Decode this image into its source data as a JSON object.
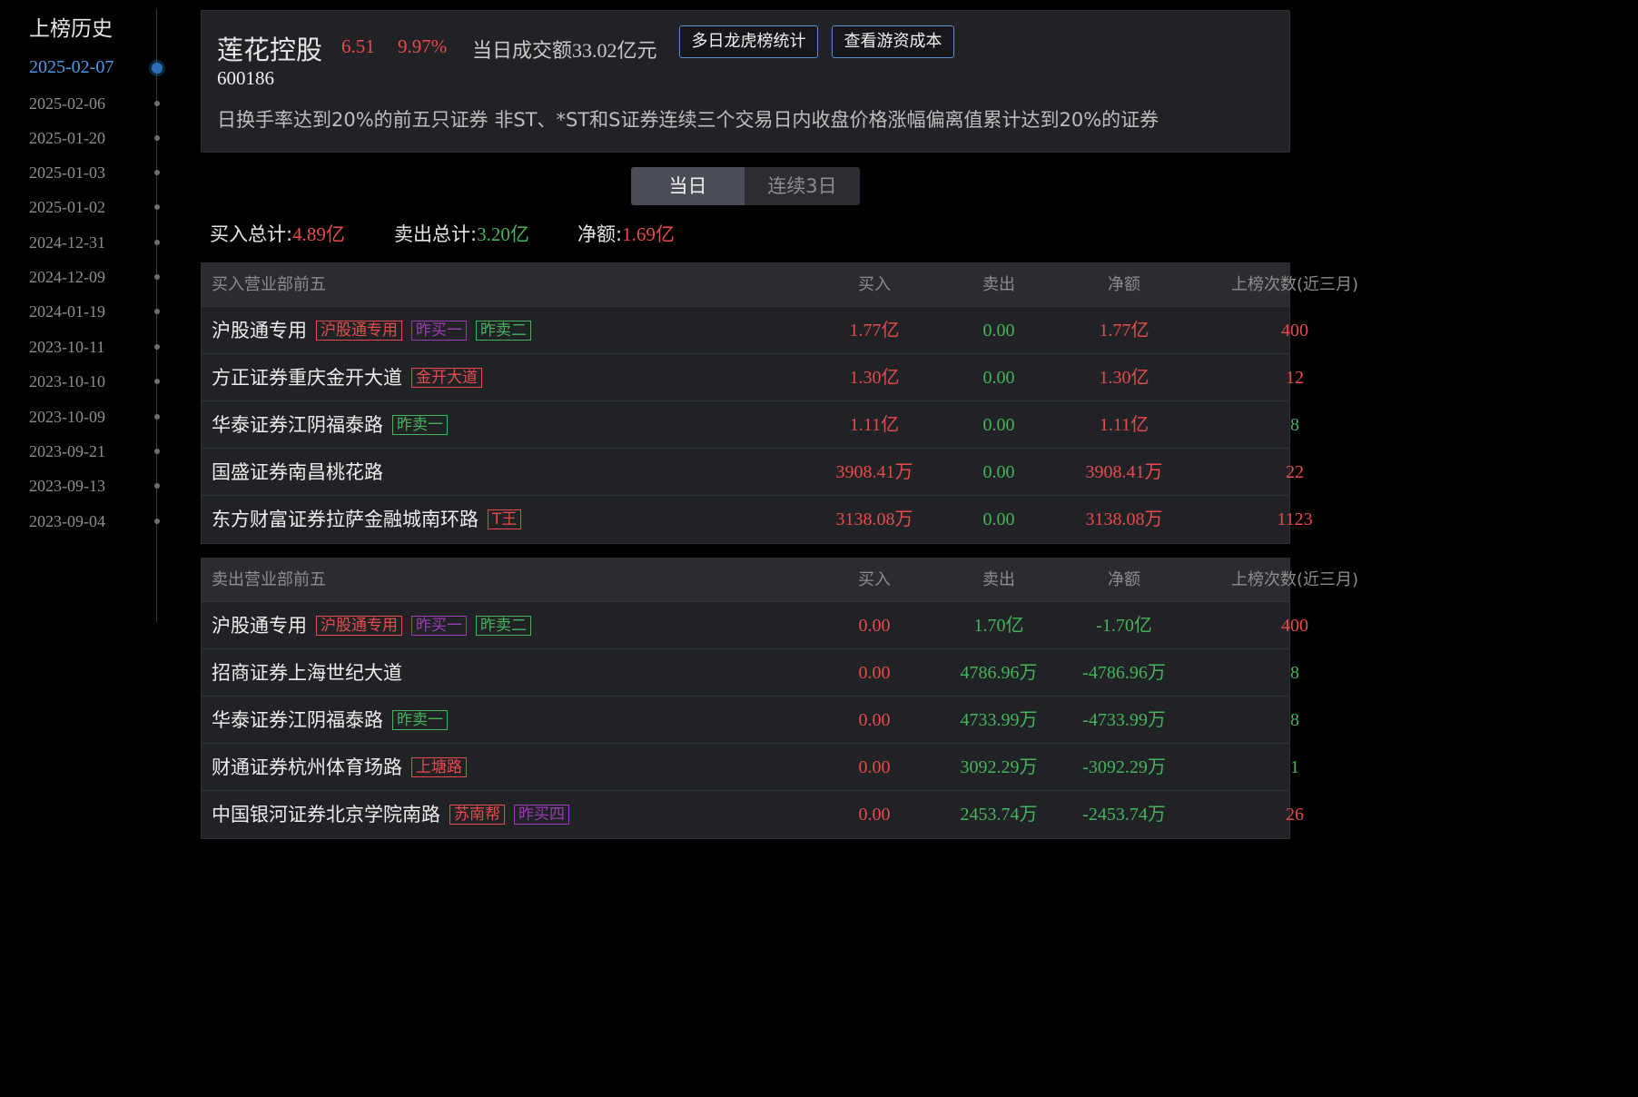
{
  "sidebar": {
    "title": "上榜历史",
    "dates": [
      "2025-02-07",
      "2025-02-06",
      "2025-01-20",
      "2025-01-03",
      "2025-01-02",
      "2024-12-31",
      "2024-12-09",
      "2024-01-19",
      "2023-10-11",
      "2023-10-10",
      "2023-10-09",
      "2023-09-21",
      "2023-09-13",
      "2023-09-04"
    ],
    "active_index": 0
  },
  "header": {
    "stock_name": "莲花控股",
    "price": "6.51",
    "change": "9.97%",
    "turnover": "当日成交额33.02亿元",
    "btn_multi_day": "多日龙虎榜统计",
    "btn_cost": "查看游资成本",
    "stock_code": "600186",
    "reason": "日换手率达到20%的前五只证券 非ST、*ST和S证券连续三个交易日内收盘价格涨幅偏离值累计达到20%的证券"
  },
  "tabs": [
    "当日",
    "连续3日"
  ],
  "summary": {
    "buy_label": "买入总计:",
    "buy_value": "4.89亿",
    "sell_label": "卖出总计:",
    "sell_value": "3.20亿",
    "net_label": "净额:",
    "net_value": "1.69亿"
  },
  "buy_table": {
    "headers": [
      "买入营业部前五",
      "买入",
      "卖出",
      "净额",
      "上榜次数(近三月)"
    ],
    "rows": [
      {
        "name": "沪股通专用",
        "tags": [
          {
            "text": "沪股通专用",
            "color": "red"
          },
          {
            "text": "昨买一",
            "color": "purple"
          },
          {
            "text": "昨卖二",
            "color": "green"
          }
        ],
        "buy": "1.77亿",
        "sell": "0.00",
        "net": "1.77亿",
        "count": "400",
        "net_color": "red",
        "count_color": "red"
      },
      {
        "name": "方正证券重庆金开大道",
        "tags": [
          {
            "text": "金开大道",
            "color": "red"
          }
        ],
        "buy": "1.30亿",
        "sell": "0.00",
        "net": "1.30亿",
        "count": "12",
        "net_color": "red",
        "count_color": "red"
      },
      {
        "name": "华泰证券江阴福泰路",
        "tags": [
          {
            "text": "昨卖一",
            "color": "green"
          }
        ],
        "buy": "1.11亿",
        "sell": "0.00",
        "net": "1.11亿",
        "count": "8",
        "net_color": "red",
        "count_color": "green"
      },
      {
        "name": "国盛证券南昌桃花路",
        "tags": [],
        "buy": "3908.41万",
        "sell": "0.00",
        "net": "3908.41万",
        "count": "22",
        "net_color": "red",
        "count_color": "red"
      },
      {
        "name": "东方财富证券拉萨金融城南环路",
        "tags": [
          {
            "text": "T王",
            "color": "red"
          }
        ],
        "buy": "3138.08万",
        "sell": "0.00",
        "net": "3138.08万",
        "count": "1123",
        "net_color": "red",
        "count_color": "red"
      }
    ]
  },
  "sell_table": {
    "headers": [
      "卖出营业部前五",
      "买入",
      "卖出",
      "净额",
      "上榜次数(近三月)"
    ],
    "rows": [
      {
        "name": "沪股通专用",
        "tags": [
          {
            "text": "沪股通专用",
            "color": "red"
          },
          {
            "text": "昨买一",
            "color": "purple"
          },
          {
            "text": "昨卖二",
            "color": "green"
          }
        ],
        "buy": "0.00",
        "sell": "1.70亿",
        "net": "-1.70亿",
        "count": "400",
        "net_color": "green",
        "count_color": "red"
      },
      {
        "name": "招商证券上海世纪大道",
        "tags": [],
        "buy": "0.00",
        "sell": "4786.96万",
        "net": "-4786.96万",
        "count": "8",
        "net_color": "green",
        "count_color": "green"
      },
      {
        "name": "华泰证券江阴福泰路",
        "tags": [
          {
            "text": "昨卖一",
            "color": "green"
          }
        ],
        "buy": "0.00",
        "sell": "4733.99万",
        "net": "-4733.99万",
        "count": "8",
        "net_color": "green",
        "count_color": "green"
      },
      {
        "name": "财通证券杭州体育场路",
        "tags": [
          {
            "text": "上塘路",
            "color": "red"
          }
        ],
        "buy": "0.00",
        "sell": "3092.29万",
        "net": "-3092.29万",
        "count": "1",
        "net_color": "green",
        "count_color": "green"
      },
      {
        "name": "中国银河证券北京学院南路",
        "tags": [
          {
            "text": "苏南帮",
            "color": "red"
          },
          {
            "text": "昨买四",
            "color": "purple"
          }
        ],
        "buy": "0.00",
        "sell": "2453.74万",
        "net": "-2453.74万",
        "count": "26",
        "net_color": "green",
        "count_color": "red"
      }
    ]
  },
  "colors": {
    "up": "#e84b4b",
    "down": "#45b45b",
    "accent": "#4f9ae8",
    "tag_purple": "#9b3bb8"
  }
}
